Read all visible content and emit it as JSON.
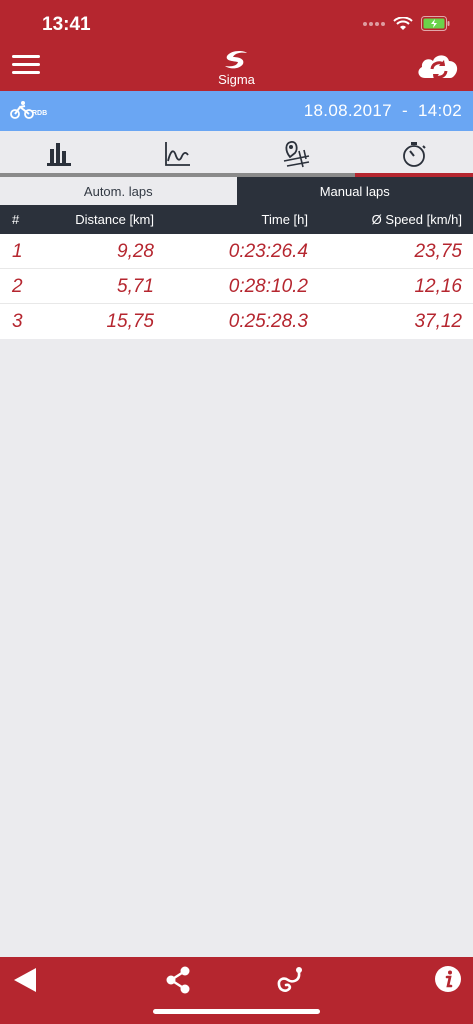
{
  "status_bar": {
    "time": "13:41"
  },
  "header": {
    "title": "Sigma",
    "menu_icon": "hamburger-icon",
    "sync_icon": "cloud-sync-icon"
  },
  "info_bar": {
    "sport_label": "RDB",
    "date": "18.08.2017",
    "separator": "-",
    "time": "14:02"
  },
  "tabs": [
    {
      "icon": "bar-chart-icon",
      "active": false
    },
    {
      "icon": "line-chart-icon",
      "active": false
    },
    {
      "icon": "route-map-icon",
      "active": false
    },
    {
      "icon": "stopwatch-icon",
      "active": true
    }
  ],
  "segment": {
    "autom_laps": "Autom. laps",
    "manual_laps": "Manual laps",
    "selected": "manual_laps"
  },
  "table": {
    "headers": {
      "num": "#",
      "distance": "Distance [km]",
      "time": "Time [h]",
      "speed": "Ø Speed [km/h]"
    },
    "rows": [
      {
        "num": "1",
        "distance": "9,28",
        "time": "0:23:26.4",
        "speed": "23,75"
      },
      {
        "num": "2",
        "distance": "5,71",
        "time": "0:28:10.2",
        "speed": "12,16"
      },
      {
        "num": "3",
        "distance": "15,75",
        "time": "0:25:28.3",
        "speed": "37,12"
      }
    ]
  },
  "bottom_bar": {
    "back_icon": "back-arrow-icon",
    "share_icon": "share-icon",
    "route_icon": "route-icon",
    "info_icon": "info-icon"
  },
  "colors": {
    "brand_red": "#b5262f",
    "info_blue": "#6aa6f3",
    "dark": "#2b313b"
  }
}
